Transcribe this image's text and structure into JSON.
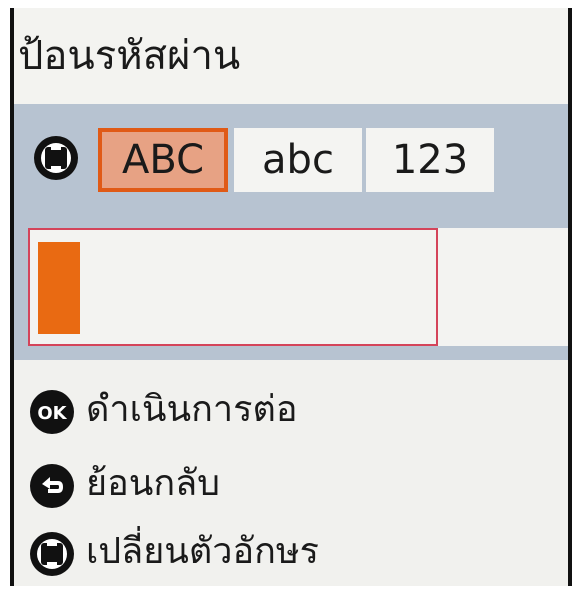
{
  "screen": {
    "title": "ป้อนรหัสผ่าน"
  },
  "input_mode": {
    "icon": "mode-switch-icon",
    "tabs": [
      {
        "label": "ABC",
        "selected": true
      },
      {
        "label": "abc",
        "selected": false
      },
      {
        "label": "123",
        "selected": false
      }
    ]
  },
  "password_field": {
    "value": "",
    "cursor_color": "#e96a12",
    "border_color": "#d4445a"
  },
  "actions": [
    {
      "icon": "ok-button-icon",
      "label": "ดำเนินการต่อ"
    },
    {
      "icon": "back-button-icon",
      "label": "ย้อนกลับ"
    },
    {
      "icon": "mode-switch-icon",
      "label": "เปลี่ยนตัวอักษร"
    }
  ],
  "colors": {
    "accent": "#e05a16",
    "selected_fill": "#e7a284",
    "band": "#b7c3d1"
  }
}
